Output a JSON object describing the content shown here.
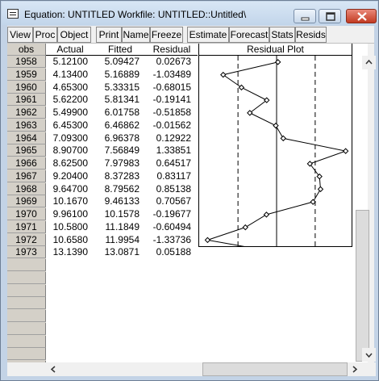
{
  "window": {
    "title": "Equation: UNTITLED   Workfile: UNTITLED::Untitled\\"
  },
  "toolbar": {
    "buttons": [
      "View",
      "Proc",
      "Object",
      "Print",
      "Name",
      "Freeze",
      "Estimate",
      "Forecast",
      "Stats",
      "Resids"
    ]
  },
  "table": {
    "headers": {
      "obs": "obs",
      "actual": "Actual",
      "fitted": "Fitted",
      "residual": "Residual",
      "plot": "Residual Plot"
    },
    "rows": [
      {
        "obs": "1958",
        "actual": "5.12100",
        "fitted": "5.09427",
        "residual": "0.02673"
      },
      {
        "obs": "1959",
        "actual": "4.13400",
        "fitted": "5.16889",
        "residual": "-1.03489"
      },
      {
        "obs": "1960",
        "actual": "4.65300",
        "fitted": "5.33315",
        "residual": "-0.68015"
      },
      {
        "obs": "1961",
        "actual": "5.62200",
        "fitted": "5.81341",
        "residual": "-0.19141"
      },
      {
        "obs": "1962",
        "actual": "5.49900",
        "fitted": "6.01758",
        "residual": "-0.51858"
      },
      {
        "obs": "1963",
        "actual": "6.45300",
        "fitted": "6.46862",
        "residual": "-0.01562"
      },
      {
        "obs": "1964",
        "actual": "7.09300",
        "fitted": "6.96378",
        "residual": "0.12922"
      },
      {
        "obs": "1965",
        "actual": "8.90700",
        "fitted": "7.56849",
        "residual": "1.33851"
      },
      {
        "obs": "1966",
        "actual": "8.62500",
        "fitted": "7.97983",
        "residual": "0.64517"
      },
      {
        "obs": "1967",
        "actual": "9.20400",
        "fitted": "8.37283",
        "residual": "0.83117"
      },
      {
        "obs": "1968",
        "actual": "9.64700",
        "fitted": "8.79562",
        "residual": "0.85138"
      },
      {
        "obs": "1969",
        "actual": "10.1670",
        "fitted": "9.46133",
        "residual": "0.70567"
      },
      {
        "obs": "1970",
        "actual": "9.96100",
        "fitted": "10.1578",
        "residual": "-0.19677"
      },
      {
        "obs": "1971",
        "actual": "10.5800",
        "fitted": "11.1849",
        "residual": "-0.60494"
      },
      {
        "obs": "1972",
        "actual": "10.6580",
        "fitted": "11.9954",
        "residual": "-1.33736"
      },
      {
        "obs": "1973",
        "actual": "13.1390",
        "fitted": "13.0871",
        "residual": "0.05188"
      }
    ]
  },
  "residual_plot": {
    "residuals": [
      0.02673,
      -1.03489,
      -0.68015,
      -0.19141,
      -0.51858,
      -0.01562,
      0.12922,
      1.33851,
      0.64517,
      0.83117,
      0.85138,
      0.70567,
      -0.19677,
      -0.60494,
      -1.33736,
      0.05188
    ],
    "band": 0.748
  }
}
